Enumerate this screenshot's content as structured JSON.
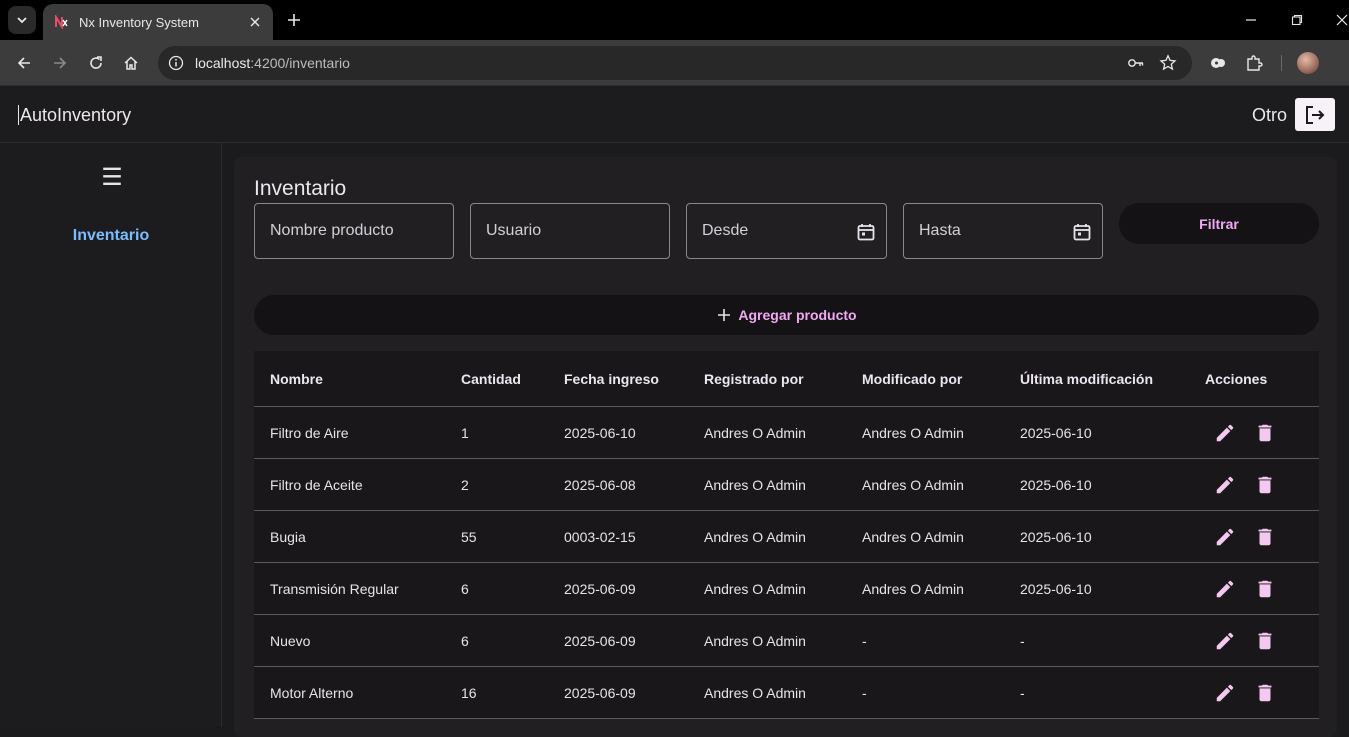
{
  "browser": {
    "tab_title": "Nx Inventory System",
    "url_host": "localhost",
    "url_rest": ":4200/inventario"
  },
  "app": {
    "brand": "AutoInventory",
    "user": "Otro"
  },
  "sidebar": {
    "menu_icon": "☰",
    "items": [
      {
        "label": "Inventario",
        "active": true
      }
    ]
  },
  "page": {
    "title": "Inventario",
    "filters": {
      "nombre_placeholder": "Nombre producto",
      "usuario_placeholder": "Usuario",
      "desde_placeholder": "Desde",
      "hasta_placeholder": "Hasta",
      "filtrar_label": "Filtrar"
    },
    "add_label": "Agregar producto"
  },
  "table": {
    "headers": [
      "Nombre",
      "Cantidad",
      "Fecha ingreso",
      "Registrado por",
      "Modificado por",
      "Última modificación",
      "Acciones"
    ],
    "rows": [
      [
        "Filtro de Aire",
        "1",
        "2025-06-10",
        "Andres O Admin",
        "Andres O Admin",
        "2025-06-10"
      ],
      [
        "Filtro de Aceite",
        "2",
        "2025-06-08",
        "Andres O Admin",
        "Andres O Admin",
        "2025-06-10"
      ],
      [
        "Bugia",
        "55",
        "0003-02-15",
        "Andres O Admin",
        "Andres O Admin",
        "2025-06-10"
      ],
      [
        "Transmisión Regular",
        "6",
        "2025-06-09",
        "Andres O Admin",
        "Andres O Admin",
        "2025-06-10"
      ],
      [
        "Nuevo",
        "6",
        "2025-06-09",
        "Andres O Admin",
        "-",
        "-"
      ],
      [
        "Motor Alterno",
        "16",
        "2025-06-09",
        "Andres O Admin",
        "-",
        "-"
      ]
    ]
  },
  "colors": {
    "accent": "#f0a9f2",
    "nav_active": "#7bbcff",
    "action_icon": "#f4c9f0"
  }
}
